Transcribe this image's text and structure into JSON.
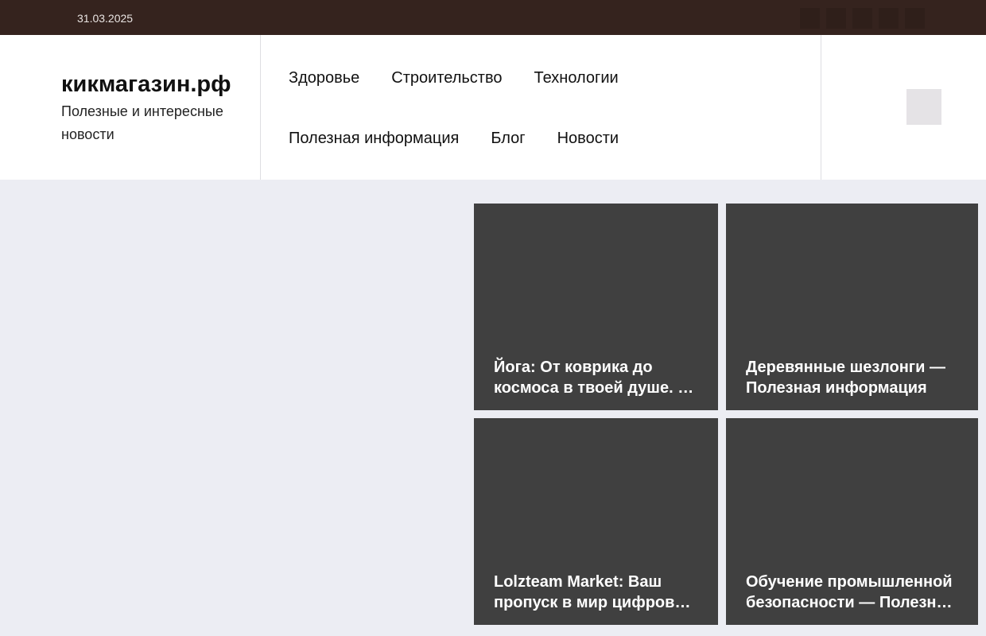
{
  "topbar": {
    "date": "31.03.2025",
    "social_icons": [
      "social-icon",
      "social-icon",
      "social-icon",
      "social-icon",
      "social-icon"
    ]
  },
  "header": {
    "site_title": "кикмагазин.рф",
    "site_description": "Полезные и интересные новости"
  },
  "nav": {
    "items": [
      {
        "label": "Здоровье"
      },
      {
        "label": "Строительство"
      },
      {
        "label": "Технологии"
      },
      {
        "label": "Полезная информация"
      },
      {
        "label": "Блог"
      },
      {
        "label": "Новости"
      }
    ]
  },
  "search": {
    "icon": "search-icon"
  },
  "featured": {
    "cards": [
      {
        "title": "Йога: От коврика до космоса в твоей душе. — Здоровье"
      },
      {
        "title": "Деревянные шезлонги — Полезная информация"
      },
      {
        "title": "Lolzteam Market: Ваш пропуск в мир цифровых товаров"
      },
      {
        "title": "Обучение промышленной безопасности — Полезная информация"
      }
    ]
  }
}
